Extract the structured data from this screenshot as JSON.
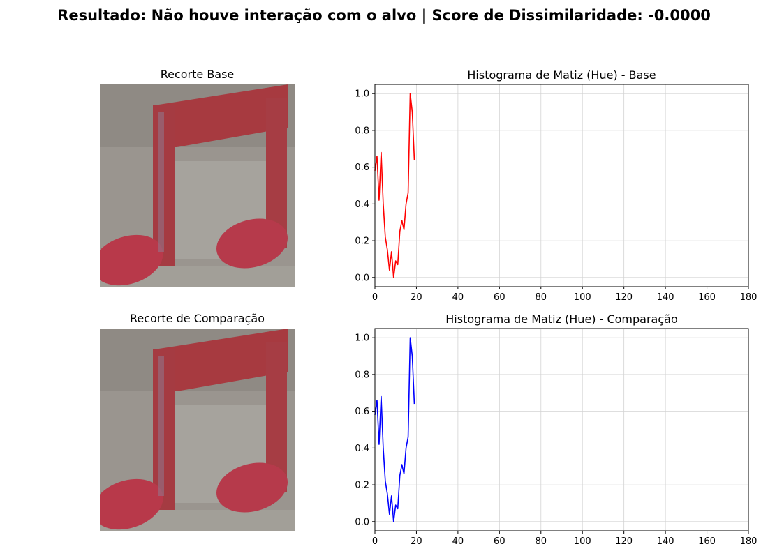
{
  "suptitle": "Resultado: Não houve interação com o alvo | Score de Dissimilaridade: -0.0000",
  "panels": {
    "base_image_title": "Recorte Base",
    "comparison_image_title": "Recorte de Comparação"
  },
  "colors": {
    "base_line": "#ff0000",
    "comparison_line": "#0000ff",
    "grid": "#d3d3d3"
  },
  "chart_data": [
    {
      "type": "line",
      "title": "Histograma de Matiz (Hue) - Base",
      "xlabel": "",
      "ylabel": "",
      "xlim": [
        0,
        180
      ],
      "ylim": [
        -0.05,
        1.05
      ],
      "xticks": [
        0,
        20,
        40,
        60,
        80,
        100,
        120,
        140,
        160,
        180
      ],
      "yticks": [
        0.0,
        0.2,
        0.4,
        0.6,
        0.8,
        1.0
      ],
      "grid": true,
      "series": [
        {
          "color": "#ff0000",
          "x": [
            0,
            1,
            2,
            3,
            4,
            5,
            6,
            7,
            8,
            9,
            10,
            11,
            12,
            13,
            14,
            15,
            16,
            17,
            18,
            19
          ],
          "y": [
            0.58,
            0.66,
            0.42,
            0.68,
            0.4,
            0.22,
            0.15,
            0.04,
            0.14,
            0.0,
            0.09,
            0.07,
            0.25,
            0.31,
            0.26,
            0.4,
            0.46,
            1.0,
            0.9,
            0.64
          ]
        }
      ]
    },
    {
      "type": "line",
      "title": "Histograma de Matiz (Hue) - Comparação",
      "xlabel": "",
      "ylabel": "",
      "xlim": [
        0,
        180
      ],
      "ylim": [
        -0.05,
        1.05
      ],
      "xticks": [
        0,
        20,
        40,
        60,
        80,
        100,
        120,
        140,
        160,
        180
      ],
      "yticks": [
        0.0,
        0.2,
        0.4,
        0.6,
        0.8,
        1.0
      ],
      "grid": true,
      "series": [
        {
          "color": "#0000ff",
          "x": [
            0,
            1,
            2,
            3,
            4,
            5,
            6,
            7,
            8,
            9,
            10,
            11,
            12,
            13,
            14,
            15,
            16,
            17,
            18,
            19
          ],
          "y": [
            0.58,
            0.66,
            0.42,
            0.68,
            0.4,
            0.22,
            0.15,
            0.04,
            0.14,
            0.0,
            0.09,
            0.07,
            0.25,
            0.31,
            0.26,
            0.4,
            0.46,
            1.0,
            0.9,
            0.64
          ]
        }
      ]
    }
  ]
}
